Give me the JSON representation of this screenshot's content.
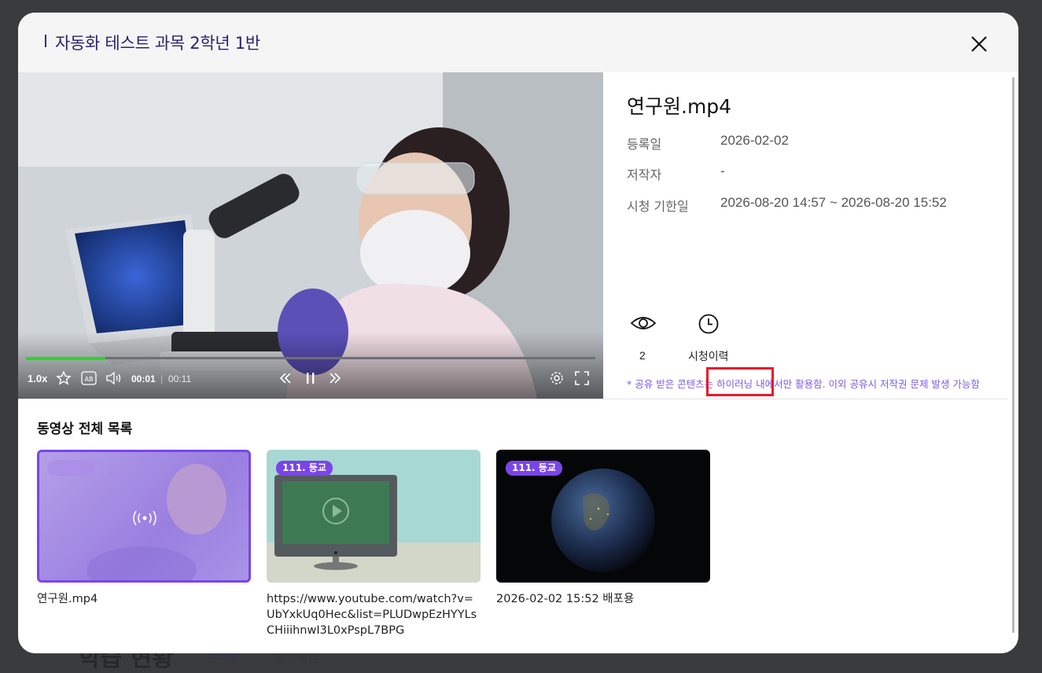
{
  "modal": {
    "title": "자동화 테스트 과목 2학년 1반"
  },
  "player": {
    "speed": "1.0x",
    "current_time": "00:01",
    "duration": "00:11",
    "progress": 0.14
  },
  "detail": {
    "filename": "연구원.mp4",
    "registered_label": "등록일",
    "registered_value": "2026-02-02",
    "author_label": "저작자",
    "author_value": "-",
    "period_label": "시청 기한일",
    "period_value": "2026-08-20 14:57 ~ 2026-08-20 15:52",
    "views": "2",
    "history_label": "시청이력",
    "notice": "* 공유 받은 콘텐츠는 하이러닝 내에서만 활용함. 이외 공유시 저작권 문제 발생 가능함"
  },
  "list": {
    "title": "동영상 전체 목록",
    "items": [
      {
        "badge": "",
        "caption": "연구원.mp4"
      },
      {
        "badge": "111. 등교",
        "caption": "https://www.youtube.com/watch?v=UbYxkUq0Hec&list=PLUDwpEzHYYLsCHiiihnwI3L0xPspL7BPG"
      },
      {
        "badge": "111. 등교",
        "caption": "2026-02-02 15:52 배포용"
      }
    ]
  },
  "background": {
    "heading": "학습 현황",
    "tab1": "우리반",
    "tab2": "함동학습"
  },
  "colors": {
    "accent": "#7a45e8",
    "progress": "#27d827",
    "highlight": "#e8192c"
  }
}
